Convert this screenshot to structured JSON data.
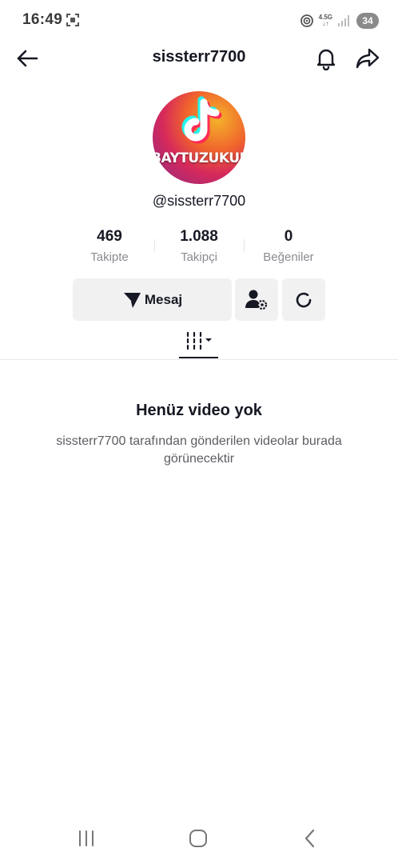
{
  "status_bar": {
    "time": "16:49",
    "network_type": "4.5G",
    "battery": "34"
  },
  "header": {
    "title": "sissterr7700"
  },
  "profile": {
    "avatar_text": "BAYTUZUKURU",
    "handle": "@sissterr7700"
  },
  "stats": [
    {
      "value": "469",
      "label": "Takipte"
    },
    {
      "value": "1.088",
      "label": "Takipçi"
    },
    {
      "value": "0",
      "label": "Beğeniler"
    }
  ],
  "actions": {
    "message_label": "Mesaj"
  },
  "empty_state": {
    "title": "Henüz video yok",
    "description": "sissterr7700 tarafından gönderilen videolar burada görünecektir"
  },
  "colors": {
    "text_primary": "#161823",
    "text_secondary": "#8a8b91",
    "button_bg": "#f1f1f2"
  },
  "icons": {
    "back": "arrow-left-icon",
    "bell": "bell-icon",
    "share": "share-arrow-icon",
    "message": "paper-plane-icon",
    "follow_settings": "user-gear-icon",
    "refresh": "refresh-icon",
    "videos_tab": "grid-columns-icon"
  }
}
